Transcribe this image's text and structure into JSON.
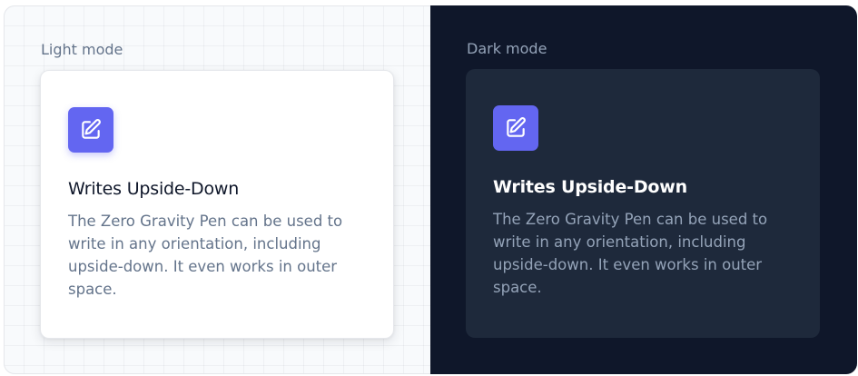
{
  "light": {
    "mode_label": "Light mode",
    "card": {
      "icon": "pencil-square-icon",
      "title": "Writes Upside-Down",
      "description": "The Zero Gravity Pen can be used to write in any orientation, including upside-down. It even works in outer space."
    }
  },
  "dark": {
    "mode_label": "Dark mode",
    "card": {
      "icon": "pencil-square-icon",
      "title": "Writes Upside-Down",
      "description": "The Zero Gravity Pen can be used to write in any orientation, including upside-down. It even works in outer space."
    }
  },
  "colors": {
    "accent": "#6366f1",
    "dark_background": "#0f172a",
    "dark_card": "#1e293b",
    "light_card": "#ffffff",
    "muted_text": "#64748b"
  }
}
